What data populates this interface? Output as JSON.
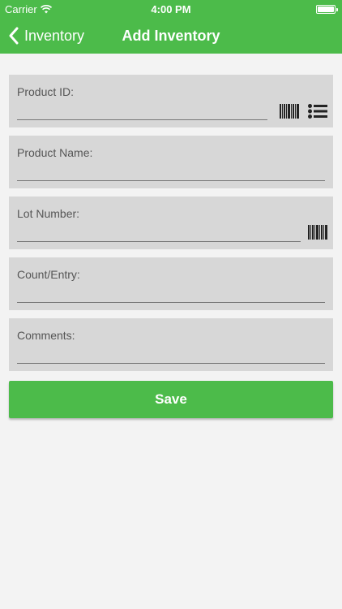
{
  "status_bar": {
    "carrier": "Carrier",
    "time": "4:00 PM",
    "icons": [
      "wifi-icon",
      "battery-icon"
    ]
  },
  "nav": {
    "back_label": "Inventory",
    "title": "Add Inventory",
    "back_icon": "chevron-left-icon"
  },
  "form": {
    "product_id": {
      "label": "Product ID:",
      "value": "",
      "placeholder": "",
      "icons": [
        "barcode-icon",
        "list-icon"
      ]
    },
    "product_name": {
      "label": "Product Name:",
      "value": "",
      "placeholder": ""
    },
    "lot_number": {
      "label": "Lot Number:",
      "value": "",
      "placeholder": "",
      "icons": [
        "barcode-icon"
      ]
    },
    "count_entry": {
      "label": "Count/Entry:",
      "value": "",
      "placeholder": ""
    },
    "comments": {
      "label": "Comments:",
      "value": "",
      "placeholder": ""
    }
  },
  "save_label": "Save",
  "colors": {
    "accent": "#4cbb4a",
    "background": "#f3f3f3",
    "field_bg": "#d7d7d7",
    "label_text": "#555555"
  }
}
